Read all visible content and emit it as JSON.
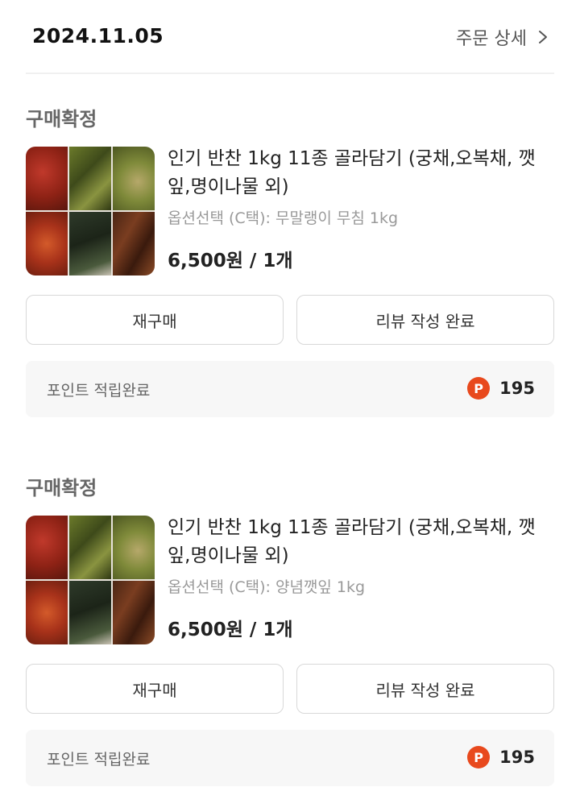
{
  "header": {
    "date": "2024.11.05",
    "detail_link": "주문 상세"
  },
  "orders": [
    {
      "status": "구매확정",
      "product_name": "인기 반찬 1kg 11종 골라담기 (궁채,오복채, 깻잎,명이나물 외)",
      "option": "옵션선택 (C택): 무말랭이 무침 1kg",
      "price": "6,500원 / 1개",
      "rebuy_label": "재구매",
      "review_label": "리뷰 작성 완료",
      "point_label": "포인트 적립완료",
      "point_icon": "P",
      "point_value": "195"
    },
    {
      "status": "구매확정",
      "product_name": "인기 반찬 1kg 11종 골라담기 (궁채,오복채, 깻잎,명이나물 외)",
      "option": "옵션선택 (C택): 양념깻잎 1kg",
      "price": "6,500원 / 1개",
      "rebuy_label": "재구매",
      "review_label": "리뷰 작성 완료",
      "point_label": "포인트 적립완료",
      "point_icon": "P",
      "point_value": "195"
    }
  ],
  "colors": {
    "point_badge": "#e8491d",
    "point_box_bg": "#f7f7f7",
    "button_border": "#d8d8d8"
  },
  "icons": {
    "detail_link": "chevron-right-icon",
    "point": "point-icon"
  }
}
